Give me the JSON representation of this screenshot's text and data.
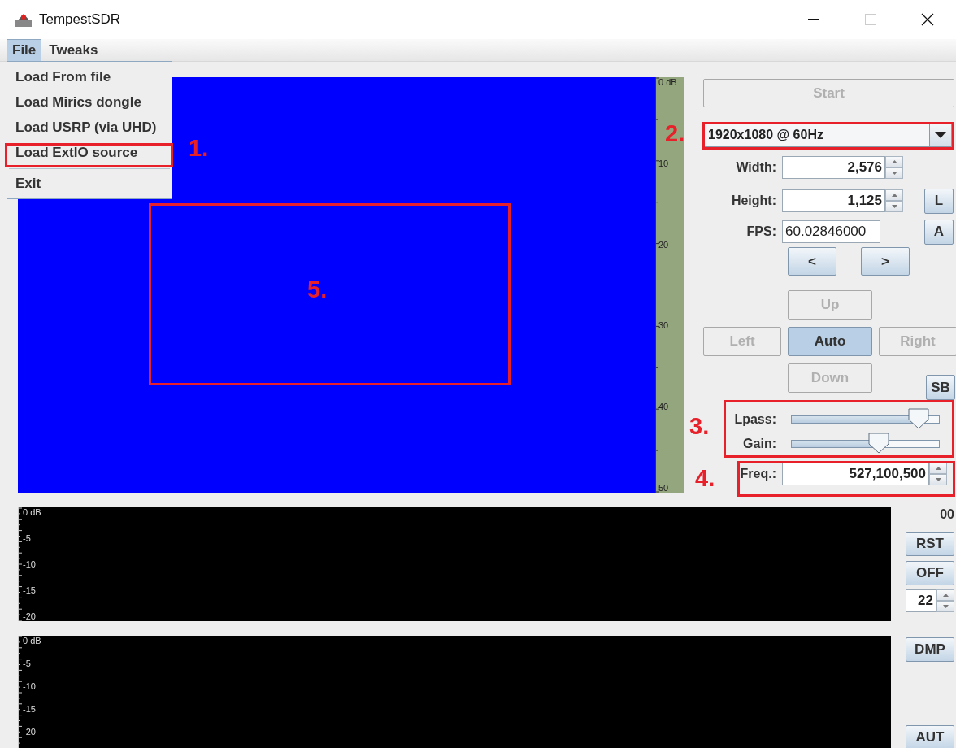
{
  "window": {
    "title": "TempestSDR"
  },
  "menu_bar": [
    {
      "label": "File",
      "selected": true
    },
    {
      "label": "Tweaks",
      "selected": false
    }
  ],
  "file_menu": {
    "items": [
      {
        "label": "Load From file",
        "separator_before": false
      },
      {
        "label": "Load Mirics dongle",
        "separator_before": false
      },
      {
        "label": "Load USRP (via UHD)",
        "separator_before": false
      },
      {
        "label": "Load ExtIO source",
        "separator_before": false
      },
      {
        "label": "Exit",
        "separator_before": true
      }
    ]
  },
  "video": {
    "scale": [
      "0 dB",
      "10",
      "20",
      "30",
      "40",
      "50"
    ]
  },
  "controls": {
    "start": {
      "label": "Start",
      "disabled": true
    },
    "resolution": {
      "value": "1920x1080 @ 60Hz"
    },
    "width": {
      "label": "Width:",
      "value": "2,576"
    },
    "height": {
      "label": "Height:",
      "value": "1,125"
    },
    "fps": {
      "label": "FPS:",
      "value": "60.02846000"
    },
    "side_buttons": [
      "L",
      "A"
    ],
    "prev": "<",
    "next": ">",
    "pad": [
      {
        "label": "Up",
        "disabled": true,
        "selected": false
      },
      {
        "label": "Left",
        "disabled": true,
        "selected": false
      },
      {
        "label": "Auto",
        "disabled": false,
        "selected": true
      },
      {
        "label": "Right",
        "disabled": true,
        "selected": false
      },
      {
        "label": "Down",
        "disabled": true,
        "selected": false
      }
    ],
    "sb": "SB",
    "sliders": [
      {
        "label": "Lpass:",
        "level": 0.86
      },
      {
        "label": "Gain:",
        "level": 0.59
      }
    ],
    "freq": {
      "label": "Freq.:",
      "value": "527,100,500"
    }
  },
  "spectrum_plots": [
    {
      "scale": [
        "0 dB",
        "-5",
        "-10",
        "-15",
        "-20"
      ]
    },
    {
      "scale": [
        "0 dB",
        "-5",
        "-10",
        "-15",
        "-20"
      ]
    }
  ],
  "side_panel": {
    "counter": "00",
    "rst": "RST",
    "off": "OFF",
    "spinner": "22",
    "dmp": "DMP",
    "aut": "AUT"
  },
  "annotations": [
    {
      "label": "1."
    },
    {
      "label": "2."
    },
    {
      "label": "5."
    },
    {
      "label": "3."
    },
    {
      "label": "4."
    }
  ]
}
